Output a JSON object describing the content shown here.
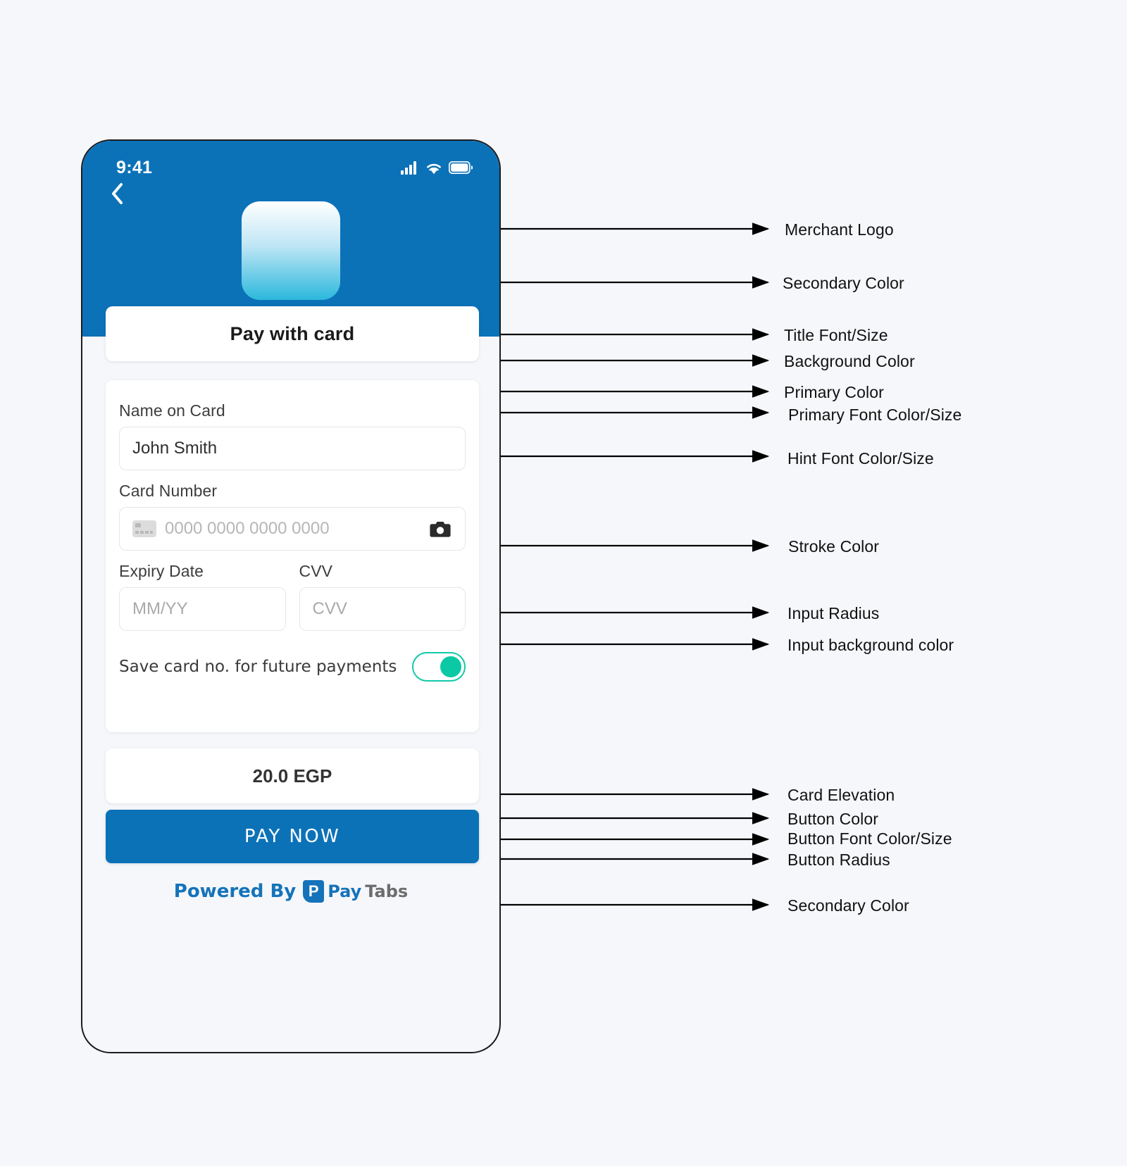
{
  "colors": {
    "primary": "#0c72b8",
    "secondary": "#2bb8dd",
    "background": "#f5f7fb",
    "page_background": "#f5f7fa",
    "stroke": "#e4e6ea",
    "input_background": "#ffffff",
    "toggle_on": "#0cc9a5",
    "paytabs_blue": "#1573b9",
    "paytabs_gray": "#6d6d6d",
    "button_font": "#ffffff",
    "primary_font": "#3d3d3d",
    "hint_font": "#b6b6b6"
  },
  "phone": {
    "status_bar": {
      "time": "9:41",
      "icons": [
        "signal-icon",
        "wifi-icon",
        "battery-icon"
      ]
    },
    "back_icon": "chevron-left-icon",
    "merchant_logo_alt": "merchant-logo"
  },
  "screen": {
    "title": "Pay with card",
    "fields": [
      {
        "label": "Name on Card",
        "value": "John Smith",
        "placeholder": ""
      },
      {
        "label": "Card Number",
        "value": "",
        "placeholder": "0000 0000 0000 0000"
      },
      {
        "label": "Expiry Date",
        "value": "",
        "placeholder": "MM/YY"
      },
      {
        "label": "CVV",
        "value": "",
        "placeholder": "CVV"
      }
    ],
    "name_label": "Name on Card",
    "name_value": "John Smith",
    "card_number_label": "Card Number",
    "card_number_placeholder": "0000 0000 0000 0000",
    "expiry_label": "Expiry Date",
    "expiry_placeholder": "MM/YY",
    "cvv_label": "CVV",
    "cvv_placeholder": "CVV",
    "save_card_label": "Save card no. for future payments",
    "save_card_on": true,
    "amount": "20.0 EGP",
    "pay_button": "PAY NOW",
    "footer": {
      "powered_by": "Powered By",
      "brand_pay": "Pay",
      "brand_tabs": "Tabs",
      "brand_mark": "P"
    },
    "icons": {
      "card": "credit-card-icon",
      "camera": "camera-icon"
    }
  },
  "annotations": [
    {
      "id": "merchant-logo",
      "label": "Merchant Logo"
    },
    {
      "id": "secondary-color-top",
      "label": "Secondary Color"
    },
    {
      "id": "title-font-size",
      "label": "Title Font/Size"
    },
    {
      "id": "background-color",
      "label": "Background Color"
    },
    {
      "id": "primary-color",
      "label": "Primary Color"
    },
    {
      "id": "primary-font",
      "label": "Primary Font Color/Size"
    },
    {
      "id": "hint-font",
      "label": "Hint Font Color/Size"
    },
    {
      "id": "stroke-color",
      "label": "Stroke Color"
    },
    {
      "id": "input-radius",
      "label": "Input Radius"
    },
    {
      "id": "input-background",
      "label": "Input background color"
    },
    {
      "id": "card-elevation",
      "label": "Card Elevation"
    },
    {
      "id": "button-color",
      "label": "Button Color"
    },
    {
      "id": "button-font",
      "label": "Button Font Color/Size"
    },
    {
      "id": "button-radius",
      "label": "Button Radius"
    },
    {
      "id": "secondary-color-bottom",
      "label": "Secondary Color"
    }
  ]
}
